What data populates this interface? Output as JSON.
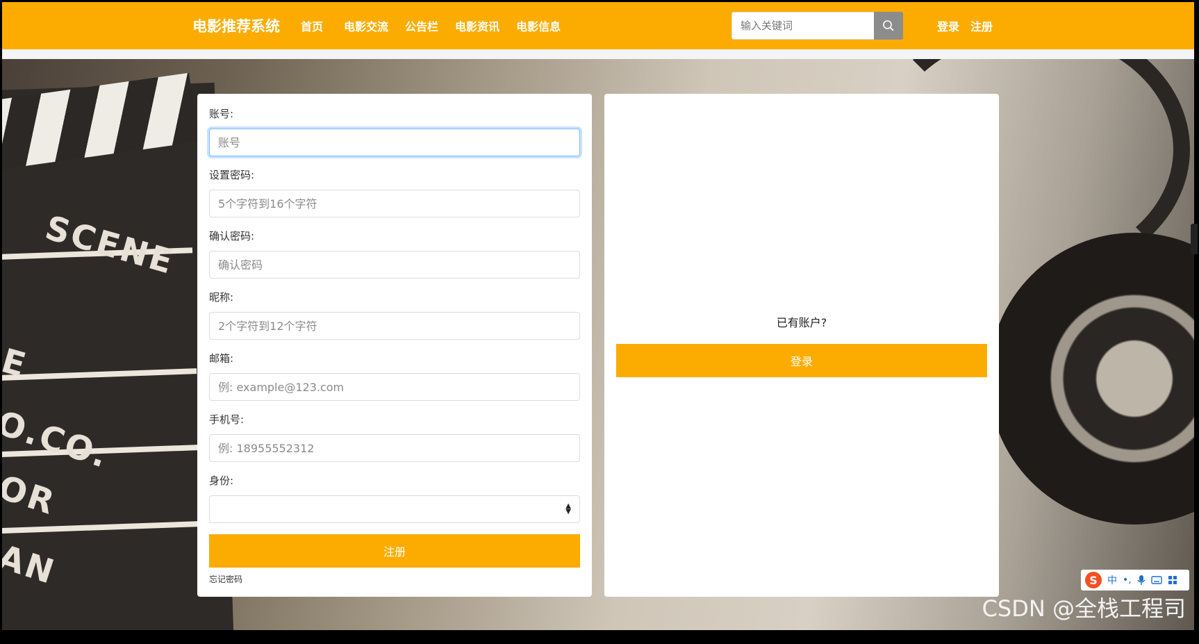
{
  "navbar": {
    "brand": "电影推荐系统",
    "links": [
      "首页",
      "电影交流",
      "公告栏",
      "电影资讯",
      "电影信息"
    ],
    "search_placeholder": "输入关键词",
    "login": "登录",
    "register": "注册"
  },
  "register_form": {
    "account_label": "账号:",
    "account_placeholder": "账号",
    "password_label": "设置密码:",
    "password_placeholder": "5个字符到16个字符",
    "confirm_label": "确认密码:",
    "confirm_placeholder": "确认密码",
    "nickname_label": "昵称:",
    "nickname_placeholder": "2个字符到12个字符",
    "email_label": "邮箱:",
    "email_placeholder": "例: example@123.com",
    "phone_label": "手机号:",
    "phone_placeholder": "例: 18955552312",
    "identity_label": "身份:",
    "identity_value": "",
    "submit_label": "注册",
    "forgot_label": "忘记密码"
  },
  "login_panel": {
    "have_account_text": "已有账户?",
    "login_button": "登录"
  },
  "background": {
    "scene_words": [
      "SCENE",
      "E",
      "O.CO.",
      "OR",
      "AN"
    ],
    "watermark": "CSDN @全栈工程司"
  },
  "ime": {
    "logo": "S",
    "mode": "中"
  },
  "colors": {
    "accent": "#fcac00",
    "focus": "#80bdff"
  }
}
